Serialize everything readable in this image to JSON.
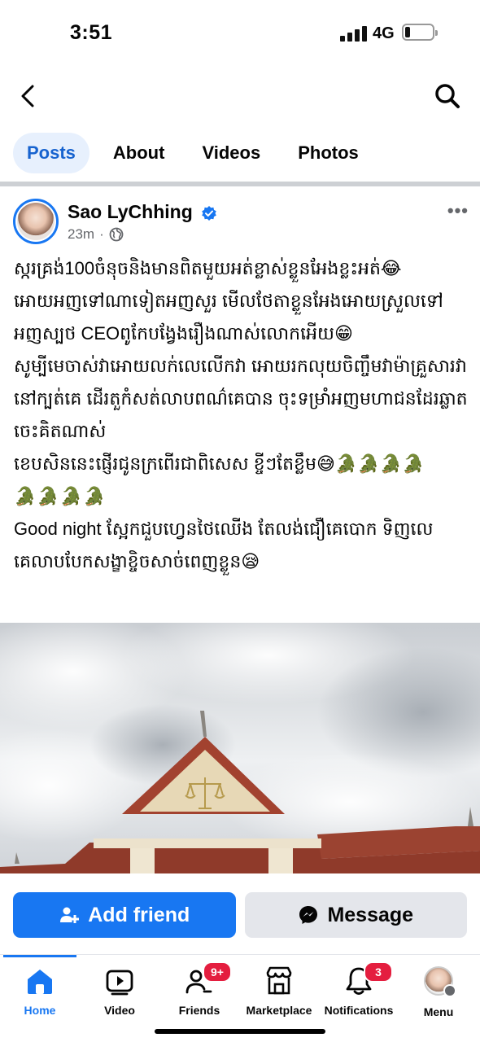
{
  "status_bar": {
    "time": "3:51",
    "network": "4G"
  },
  "tabs": [
    {
      "label": "Posts",
      "active": true
    },
    {
      "label": "About",
      "active": false
    },
    {
      "label": "Videos",
      "active": false
    },
    {
      "label": "Photos",
      "active": false
    }
  ],
  "post": {
    "author": "Sao LyChhing",
    "time": "23m",
    "separator": "·",
    "text": {
      "line1": "ស្ករគ្រង់100ចំនុចនិងមានពិតមួយអត់ខ្លាស់ខ្លួនអែងខ្លះអត់😂 អោយអញទៅណាទៀតអញសួរ មើលថែតាខ្លួនអែងអោយស្រួលទៅ អញស្បថ CEOពូកែបង្វែងរឿងណាស់លោកអើយ😁",
      "line2": "សូម្បីមេចាស់វាអោយលក់លេលើកវា  អោយរកលុយចិញ្ចឹមវាម៉ាគ្រួសារវានៅក្បត់គេ ដើរតួកំសត់លាបពណ៌គេបាន ចុះទម្រាំអញមហាជនដែរឆ្លាតចេះគិតណាស់",
      "line3": "ខេបសិននេះផ្ញើរជូនក្រពើរជាពិសេស ខ្ចីៗតែខ្លឹម😅🐊🐊🐊🐊",
      "line4": "🐊🐊🐊🐊",
      "line5": "Good night ស្អែកជួបហ្វេនថៃឈើង តែលង់ជឿគេបោក ទិញលេគេលាបបែកសង្ខាខ្ចិចសាច់ពេញខ្លួន😪"
    }
  },
  "actions": {
    "add_friend": "Add friend",
    "message": "Message"
  },
  "bottom_nav": [
    {
      "label": "Home",
      "icon": "home-icon",
      "active": true
    },
    {
      "label": "Video",
      "icon": "video-icon",
      "active": false
    },
    {
      "label": "Friends",
      "icon": "friends-icon",
      "badge": "9+",
      "active": false
    },
    {
      "label": "Marketplace",
      "icon": "marketplace-icon",
      "active": false
    },
    {
      "label": "Notifications",
      "icon": "bell-icon",
      "badge": "3",
      "active": false
    },
    {
      "label": "Menu",
      "icon": "menu-avatar",
      "active": false
    }
  ],
  "colors": {
    "accent": "#1877f2",
    "tab_active_bg": "#e7f0fd",
    "badge": "#e41e3f",
    "secondary_btn": "#e4e6eb"
  }
}
